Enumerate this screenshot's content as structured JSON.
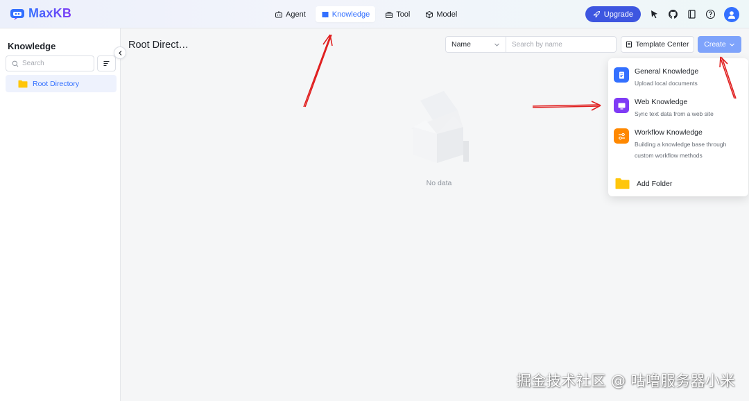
{
  "app": {
    "name": "MaxKB"
  },
  "nav": {
    "items": [
      {
        "label": "Agent",
        "icon": "agent-icon",
        "active": false
      },
      {
        "label": "Knowledge",
        "icon": "book-icon",
        "active": true
      },
      {
        "label": "Tool",
        "icon": "toolbox-icon",
        "active": false
      },
      {
        "label": "Model",
        "icon": "cube-icon",
        "active": false
      }
    ]
  },
  "header": {
    "upgrade_label": "Upgrade",
    "icons": [
      "cursor-icon",
      "github-icon",
      "docs-icon",
      "help-icon",
      "user-avatar-icon"
    ],
    "accent": "#3370ff",
    "upgrade_color": "#3d56e0"
  },
  "sidebar": {
    "title": "Knowledge",
    "search_placeholder": "Search",
    "tree": [
      {
        "label": "Root Directory",
        "icon": "folder-icon",
        "selected": true
      }
    ]
  },
  "main": {
    "breadcrumb": "Root Direct…",
    "filter": {
      "selected": "Name",
      "search_placeholder": "Search by name"
    },
    "template_label": "Template Center",
    "create_label": "Create",
    "empty_text": "No data"
  },
  "create_menu": {
    "items": [
      {
        "title": "General Knowledge",
        "desc": "Upload local documents",
        "icon": "document-icon",
        "color": "#3370ff"
      },
      {
        "title": "Web Knowledge",
        "desc": "Sync text data from a web site",
        "icon": "web-icon",
        "color": "#7f3bf5"
      },
      {
        "title": "Workflow Knowledge",
        "desc": "Building a knowledge base through custom workflow methods",
        "icon": "workflow-icon",
        "color": "#ff8800"
      }
    ],
    "folder_label": "Add Folder",
    "folder_color": "#ffc60a"
  },
  "watermark": "掘金技术社区 @ 咕噜服务器小米"
}
